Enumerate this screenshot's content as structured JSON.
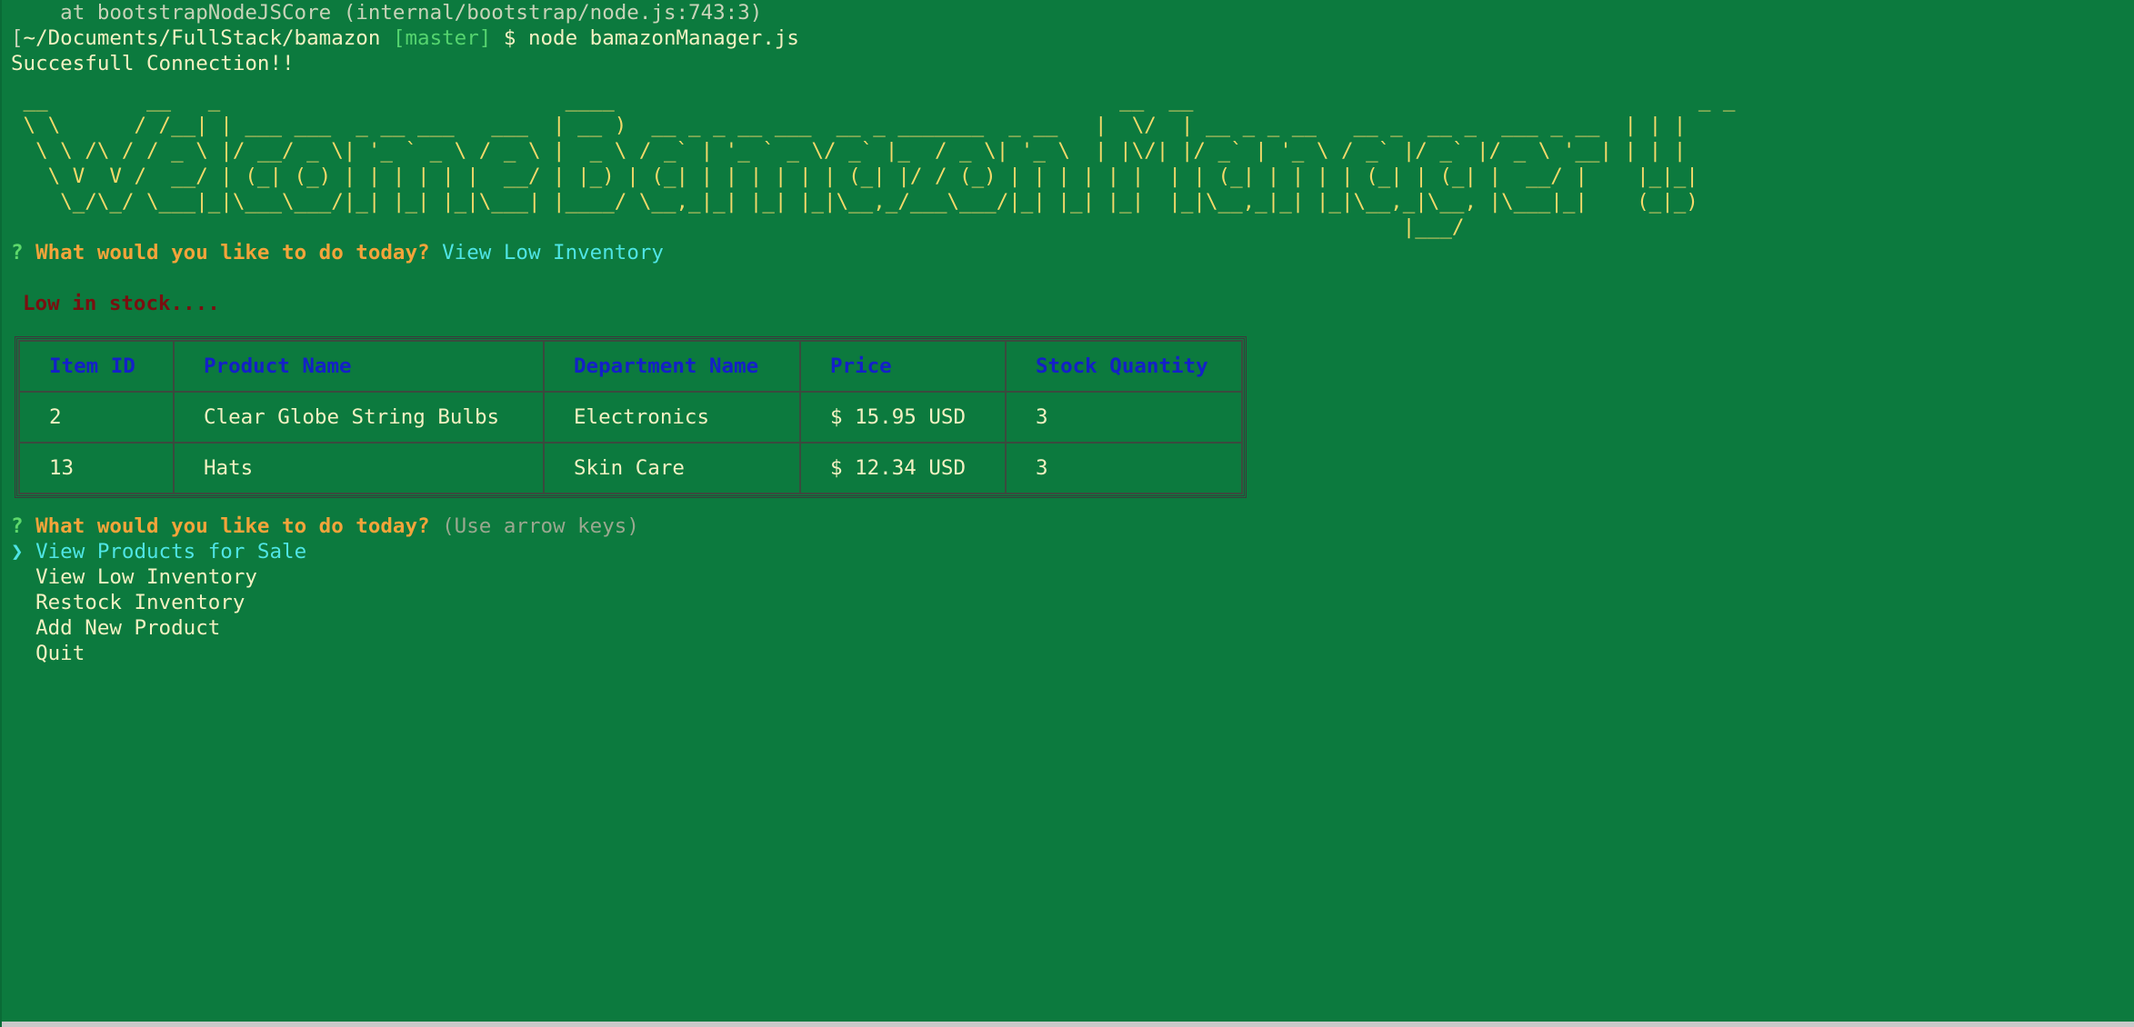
{
  "terminal": {
    "stack_line": "    at bootstrapNodeJSCore (internal/bootstrap/node.js:743:3)",
    "prompt": {
      "bracket": "[",
      "path": "~/Documents/FullStack/bamazon",
      "branch": "[master]",
      "dollar": "$",
      "command": "node bamazonManager.js"
    },
    "connection_message": "Succesfull Connection!!",
    "banner": " __        __   _                            ____                                         __  __                                         _ _\n \\ \\      / /__| | ___ ___  _ __ ___   ___  | __ )  __ _ _ __ ___  __ _ _______  _ __   |  \\/  | __ _ _ __   __ _  __ _  ___ _ __  | | |\n  \\ \\ /\\ / / _ \\ |/ __/ _ \\| '_ ` _ \\ / _ \\ |  _ \\ / _` | '_ ` _ \\/ _` |_  / _ \\| '_ \\  | |\\/| |/ _` | '_ \\ / _` |/ _` |/ _ \\ '__| | | |\n   \\ V  V /  __/ | (_| (_) | | | | | |  __/ | |_) | (_| | | | | | | (_| |/ / (_) | | | | | |  | | (_| | | | | (_| | (_| |  __/ |    |_|_|\n    \\_/\\_/ \\___|_|\\___\\___/|_| |_| |_|\\___| |____/ \\__,_|_| |_| |_|\\__,_/___\\___/|_| |_| |_|  |_|\\__,_|_| |_|\\__,_|\\__, |\\___|_|    (_|_)\n                                                                                                                 |___/"
  },
  "question1": {
    "mark": "?",
    "text": "What would you like to do today?",
    "answer": "View Low Inventory"
  },
  "low_stock_heading": "Low in stock....",
  "table": {
    "headers": [
      "Item ID",
      "Product Name",
      "Department Name",
      "Price",
      "Stock Quantity"
    ],
    "rows": [
      {
        "id": "2",
        "name": "Clear Globe String Bulbs",
        "department": "Electronics",
        "price": "$ 15.95 USD",
        "qty": "3"
      },
      {
        "id": "13",
        "name": "Hats",
        "department": "Skin Care",
        "price": "$ 12.34 USD",
        "qty": "3"
      }
    ]
  },
  "question2": {
    "mark": "?",
    "text": "What would you like to do today?",
    "hint": "(Use arrow keys)",
    "pointer": "❯",
    "options": [
      "View Products for Sale",
      "View Low Inventory",
      "Restock Inventory",
      "Add New Product",
      "Quit"
    ]
  },
  "colors": {
    "background": "#0c7a3e",
    "prompt_orange": "#f3a43a",
    "answer_cyan": "#4fe5e5",
    "header_blue": "#1420c8",
    "warning_red": "#7a0f10",
    "banner_yellow": "#f4d96a"
  }
}
